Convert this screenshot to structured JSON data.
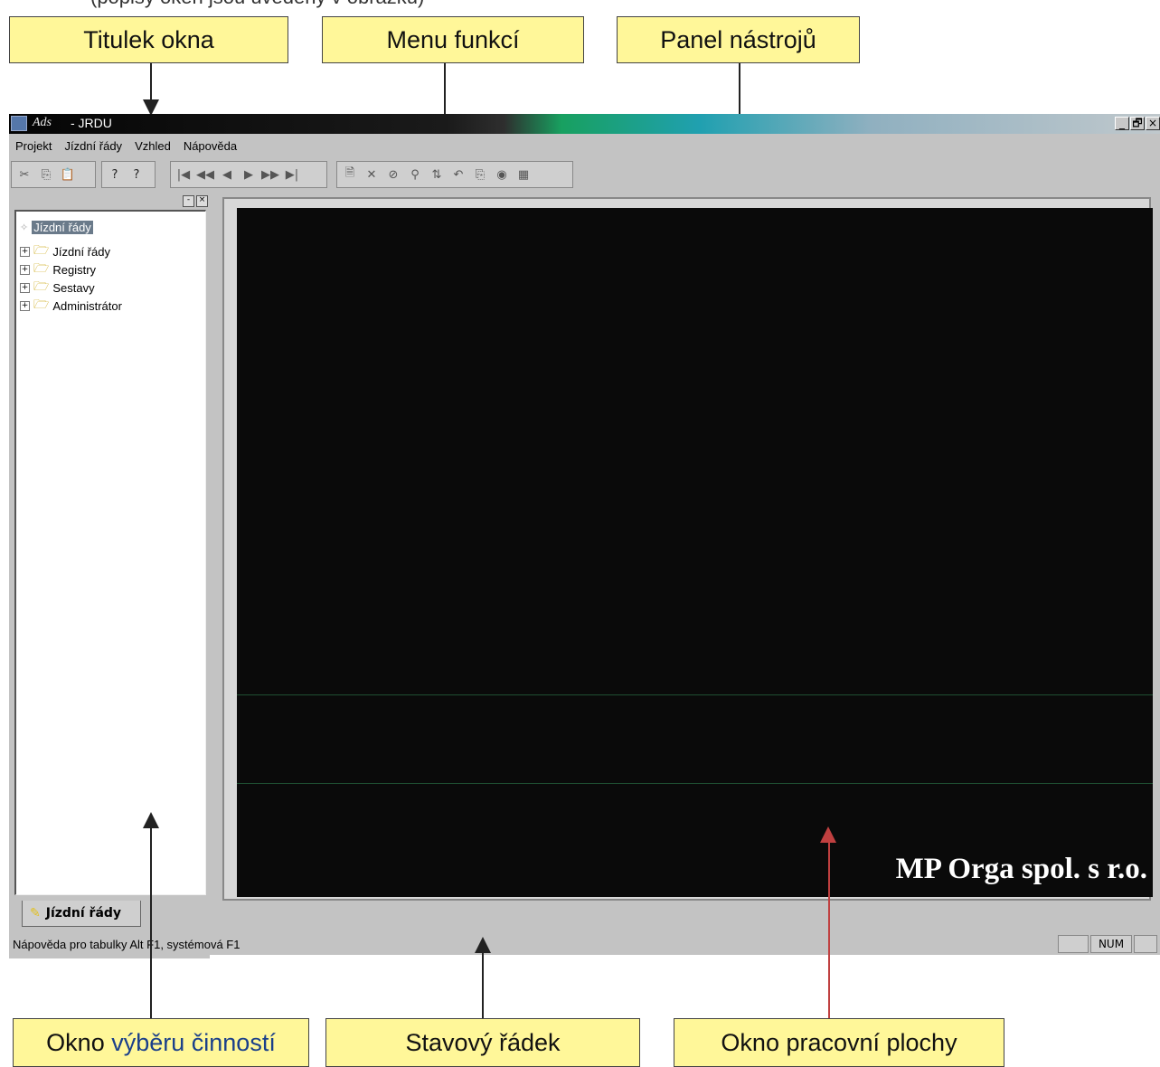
{
  "annotations": {
    "window_title": "Titulek okna",
    "function_menu": "Menu funkcí",
    "toolbar_panel": "Panel nástrojů",
    "activity_window_word1": "Okno",
    "activity_window_rest": "výběru činností",
    "status_line": "Stavový řádek",
    "work_area_window": "Okno pracovní plochy",
    "top_partial": "(popisy oken jsou uvedeny v obrázku)"
  },
  "app": {
    "title_italic": "Ads",
    "title": "- JRDU",
    "window_controls": [
      "_",
      "🗗",
      "×"
    ],
    "menu": [
      "Projekt",
      "Jízdní řády",
      "Vzhled",
      "Nápověda"
    ],
    "toolbar_groups": [
      [
        "✂",
        "⎘",
        "📋"
      ],
      [
        "?",
        "?"
      ],
      [
        "|◀",
        "◀◀",
        "◀",
        "▶",
        "▶▶",
        "▶|"
      ],
      [
        "🗎",
        "✕",
        "⊘",
        "⚲",
        "⇅",
        "↶",
        "⎘",
        "◉",
        "▦"
      ]
    ],
    "tree": {
      "root": "Jízdní řády",
      "items": [
        "Jízdní řády",
        "Registry",
        "Sestavy",
        "Administrátor"
      ]
    },
    "tab_label": "Jízdní řády",
    "workspace_brand": "MP Orga spol. s r.o.",
    "status_text": "Nápověda pro tabulky Alt F1, systémová  F1",
    "status_num": "NUM"
  },
  "colors": {
    "callout": "#fff799",
    "workspace": "#0a0a0a",
    "title_left": "#050505",
    "title_mid": "#18a060",
    "title_right": "#c0c8cc"
  }
}
